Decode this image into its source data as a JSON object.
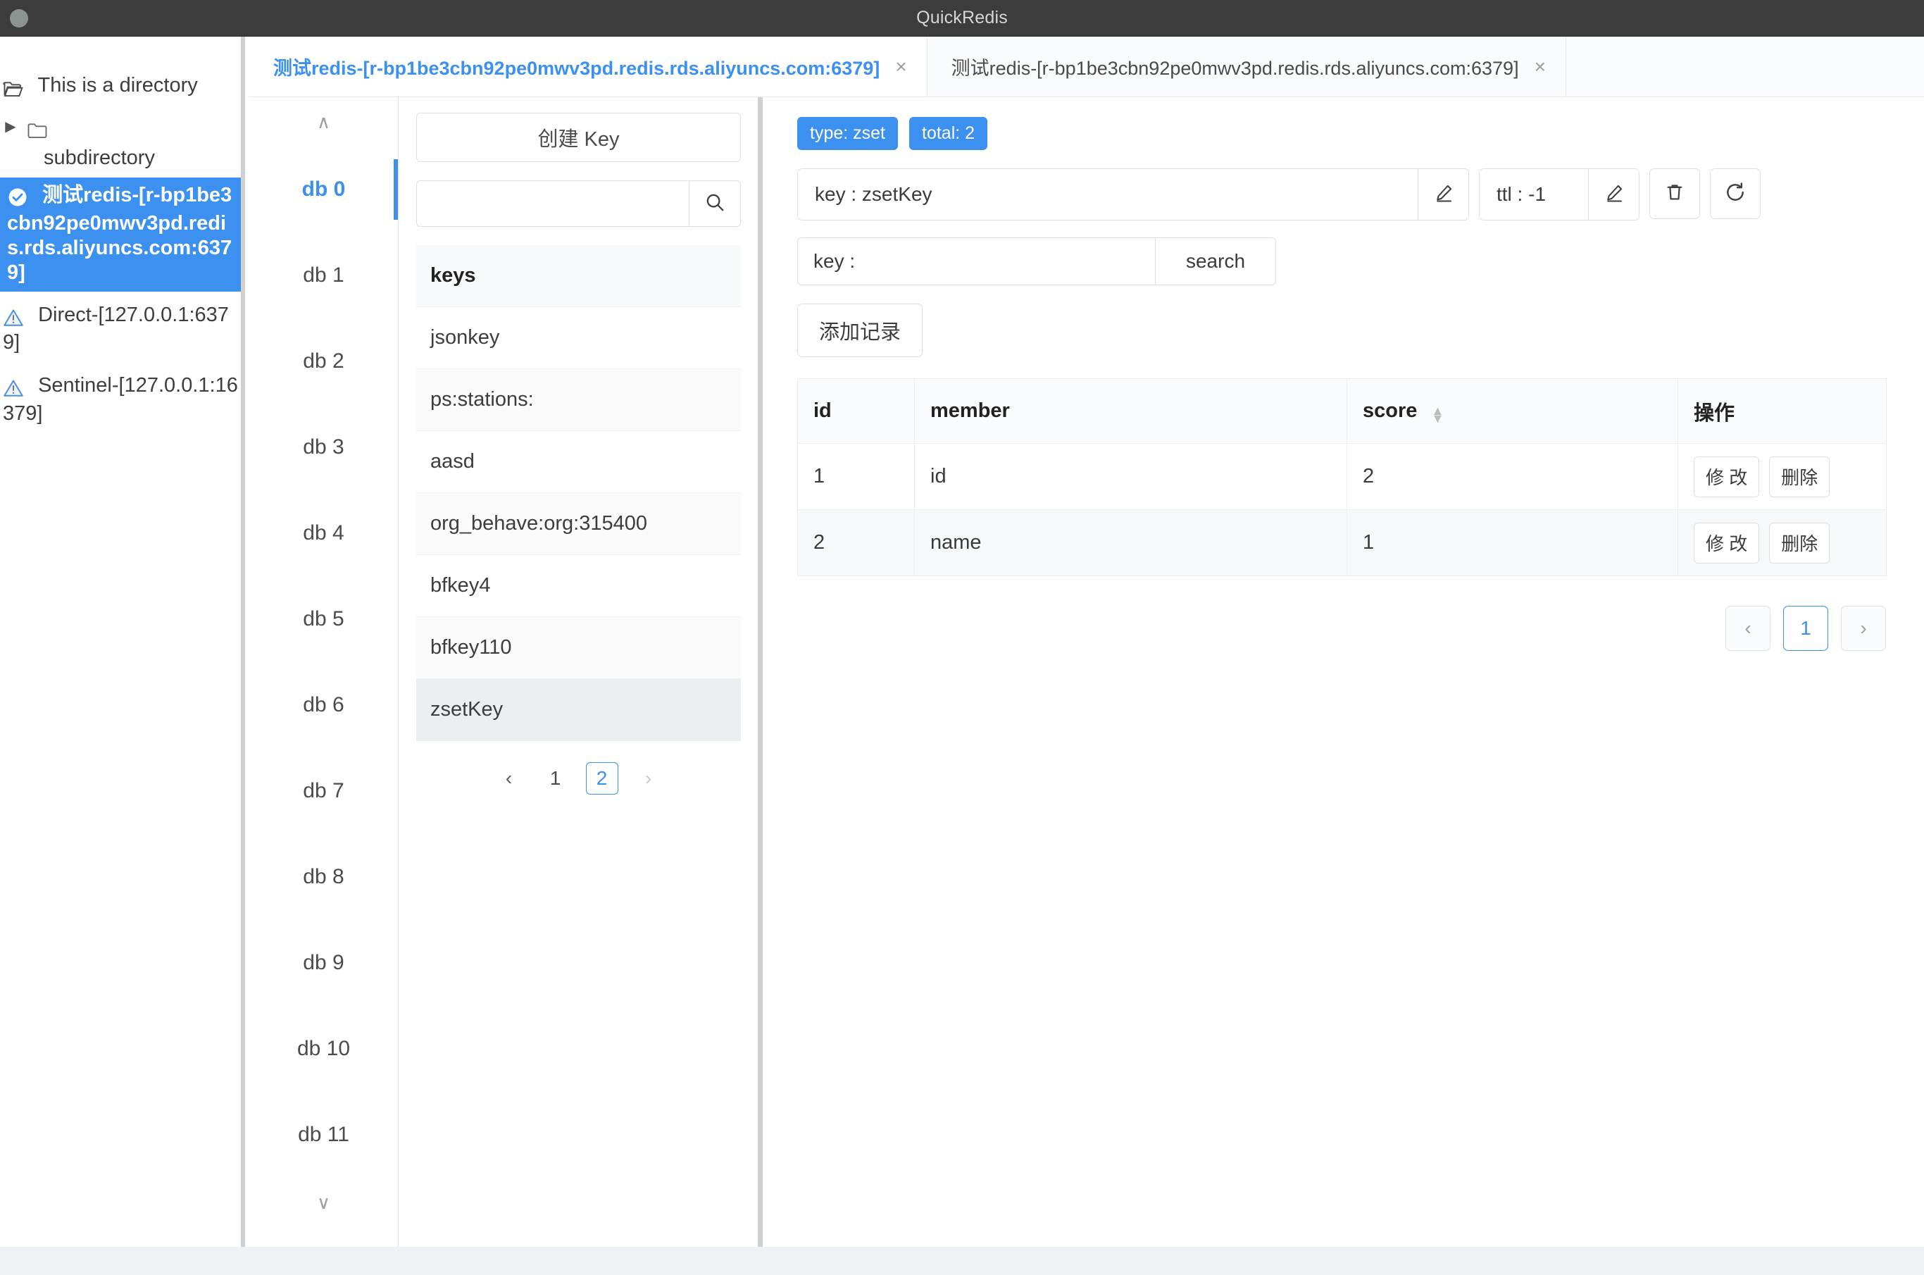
{
  "window": {
    "title": "QuickRedis"
  },
  "connections": {
    "root": {
      "label": "This is a directory",
      "icon": "open-folder-icon"
    },
    "child": {
      "label": "subdirectory",
      "icon": "folder-icon",
      "arrow": "▶"
    },
    "items": [
      {
        "label": "测试redis-[r-bp1be3cbn92pe0mwv3pd.redis.rds.aliyuncs.com:6379]",
        "icon": "check-circle-icon",
        "selected": true
      },
      {
        "label": "Direct-[127.0.0.1:6379]",
        "icon": "warning-icon",
        "selected": false
      },
      {
        "label": "Sentinel-[127.0.0.1:16379]",
        "icon": "warning-icon",
        "selected": false
      }
    ]
  },
  "tabs": [
    {
      "label": "测试redis-[r-bp1be3cbn92pe0mwv3pd.redis.rds.aliyuncs.com:6379]",
      "close": "×",
      "active": true
    },
    {
      "label": "测试redis-[r-bp1be3cbn92pe0mwv3pd.redis.rds.aliyuncs.com:6379]",
      "close": "×",
      "active": false
    }
  ],
  "db_panel": {
    "scroll_up": "∧",
    "scroll_down": "∨",
    "items": [
      "db 0",
      "db 1",
      "db 2",
      "db 3",
      "db 4",
      "db 5",
      "db 6",
      "db 7",
      "db 8",
      "db 9",
      "db 10",
      "db 11"
    ],
    "selected_index": 0
  },
  "keys_panel": {
    "create_button": "创建 Key",
    "search_placeholder": "",
    "search_value": "",
    "search_icon": "search-icon",
    "header": "keys",
    "items": [
      "jsonkey",
      "ps:stations:",
      "aasd",
      "org_behave:org:315400",
      "bfkey4",
      "bfkey110",
      "zsetKey"
    ],
    "selected_key": "zsetKey",
    "pager": {
      "prev": "‹",
      "next": "›",
      "pages": [
        "1",
        "2"
      ],
      "current": "2"
    }
  },
  "main": {
    "badges": [
      {
        "label": "type: zset",
        "color": "#3c90f0"
      },
      {
        "label": "total: 2",
        "color": "#3c90f0"
      }
    ],
    "key_field": {
      "value": "key : zsetKey",
      "edit_icon": "pencil-icon"
    },
    "ttl_field": {
      "value": "ttl : -1",
      "edit_icon": "pencil-icon"
    },
    "delete_icon": "trash-icon",
    "refresh_icon": "refresh-icon",
    "search": {
      "value": "key :",
      "placeholder": "key :",
      "button": "search"
    },
    "add_record_button": "添加记录",
    "table": {
      "columns": [
        "id",
        "member",
        "score",
        "操作"
      ],
      "sortable_column": "score",
      "rows": [
        {
          "id": "1",
          "member": "id",
          "score": "2",
          "edit": "修 改",
          "delete": "删除"
        },
        {
          "id": "2",
          "member": "name",
          "score": "1",
          "edit": "修 改",
          "delete": "删除"
        }
      ]
    },
    "pager": {
      "prev": "‹",
      "next": "›",
      "pages": [
        "1"
      ],
      "current": "1"
    }
  }
}
